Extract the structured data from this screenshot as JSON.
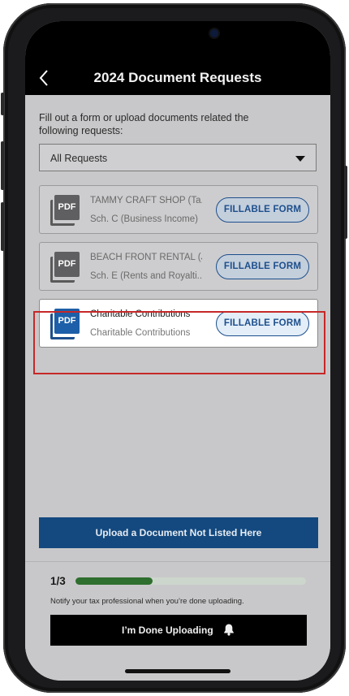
{
  "header": {
    "title": "2024 Document Requests"
  },
  "intro": {
    "text": "Fill out a form or upload documents related the following requests:"
  },
  "filter": {
    "selected": "All Requests"
  },
  "requests": [
    {
      "title": "TAMMY CRAFT SHOP (Ta...",
      "subtitle": "Sch. C (Business Income)",
      "button": "FILLABLE FORM",
      "icon": "pdf-icon",
      "active": false
    },
    {
      "title": "BEACH FRONT RENTAL  (J...",
      "subtitle": "Sch. E (Rents and Royalti...",
      "button": "FILLABLE FORM",
      "icon": "pdf-icon",
      "active": false
    },
    {
      "title": "Charitable Contributions",
      "subtitle": "Charitable Contributions",
      "button": "FILLABLE FORM",
      "icon": "pdf-icon",
      "active": true
    }
  ],
  "pdf_label": "PDF",
  "upload": {
    "label": "Upload a Document Not Listed Here"
  },
  "progress": {
    "count": "1/3",
    "fraction": 0.333
  },
  "notify": {
    "text": "Notify your tax professional when you’re done uploading."
  },
  "done": {
    "label": "I’m Done Uploading"
  },
  "colors": {
    "brand_blue": "#13497f",
    "progress_green": "#2e6e2e",
    "highlight_red": "#c62828"
  }
}
